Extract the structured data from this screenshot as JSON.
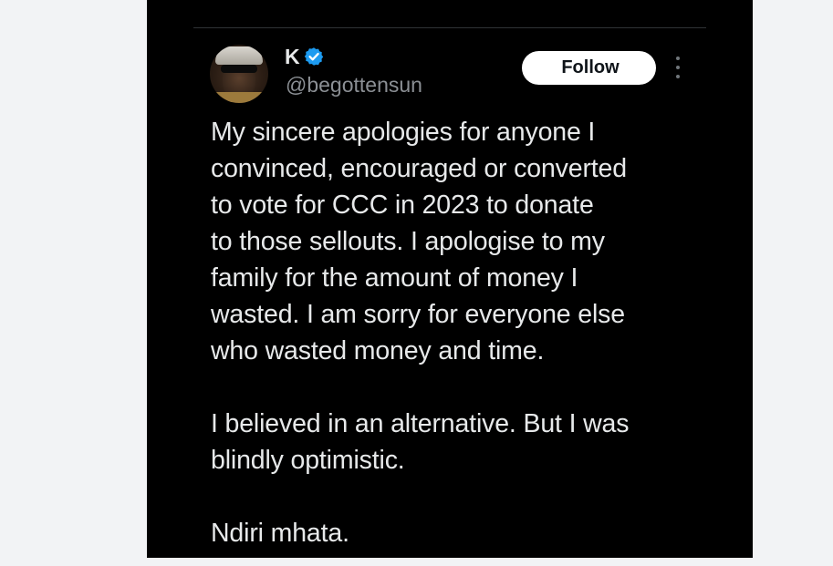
{
  "tweet": {
    "author": {
      "display_name": "K",
      "handle": "@begottensun",
      "verified_icon": "verified-badge-icon",
      "verified_color": "#1d9bf0"
    },
    "follow_label": "Follow",
    "more_icon": "more-vertical-icon",
    "lines": [
      "My sincere apologies for anyone I",
      "convinced, encouraged or converted",
      "to vote for CCC in 2023 to donate",
      "to those sellouts. I apologise to my",
      "family for the amount of money I",
      "wasted. I am sorry for everyone else",
      "who wasted money and time.",
      "",
      "I believed in an alternative. But I was",
      "blindly optimistic.",
      "",
      "Ndiri mhata."
    ]
  },
  "colors": {
    "card_background": "#000000",
    "page_background": "#f2f3f5",
    "text_primary": "#e7e9ea",
    "text_secondary": "#8b8f94",
    "button_background": "#ffffff"
  }
}
